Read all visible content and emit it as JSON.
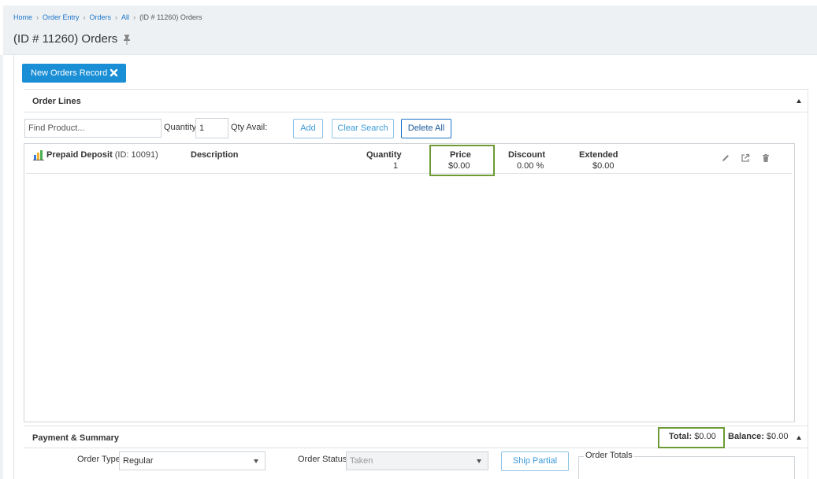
{
  "breadcrumb": {
    "items": [
      "Home",
      "Order Entry",
      "Orders",
      "All"
    ],
    "current": "(ID # 11260) Orders"
  },
  "page": {
    "title": "(ID # 11260) Orders"
  },
  "actions": {
    "new_record_label": "New Orders Record"
  },
  "order_lines": {
    "section_title": "Order Lines",
    "find_placeholder": "Find Product...",
    "quantity_label": "Quantity",
    "quantity_value": "1",
    "qty_avail_label": "Qty Avail:",
    "add_label": "Add",
    "clear_label": "Clear Search",
    "delete_all_label": "Delete All",
    "columns": {
      "description": "Description",
      "quantity": "Quantity",
      "price": "Price",
      "discount": "Discount",
      "extended": "Extended"
    },
    "rows": [
      {
        "product": "Prepaid Deposit",
        "id": "(ID: 10091)",
        "quantity": "1",
        "price": "$0.00",
        "discount": "0.00 %",
        "extended": "$0.00"
      }
    ]
  },
  "payment": {
    "section_title": "Payment & Summary",
    "total_label": "Total:",
    "total_value": "$0.00",
    "balance_label": "Balance:",
    "balance_value": "$0.00",
    "order_type_label": "Order Type",
    "order_type_value": "Regular",
    "order_status_label": "Order Status",
    "order_status_value": "Taken",
    "ship_partial_label": "Ship Partial",
    "order_totals_label": "Order Totals"
  },
  "colors": {
    "primary_button": "#1a8fd6",
    "highlight_border": "#6d9a34",
    "link": "#1a73c9"
  }
}
